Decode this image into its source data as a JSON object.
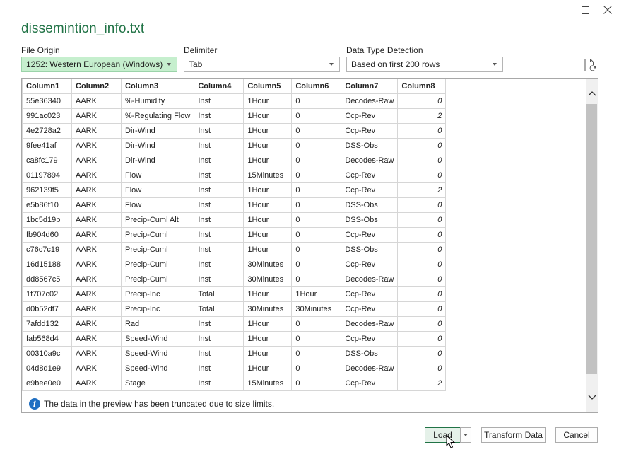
{
  "window": {
    "title": "dissemintion_info.txt"
  },
  "fields": {
    "file_origin": {
      "label": "File Origin",
      "value": "1252: Western European (Windows)"
    },
    "delimiter": {
      "label": "Delimiter",
      "value": "Tab"
    },
    "data_type_detection": {
      "label": "Data Type Detection",
      "value": "Based on first 200 rows"
    }
  },
  "table": {
    "columns": [
      "Column1",
      "Column2",
      "Column3",
      "Column4",
      "Column5",
      "Column6",
      "Column7",
      "Column8"
    ],
    "rows": [
      [
        "55e36340",
        "AARK",
        "%-Humidity",
        "Inst",
        "1Hour",
        "0",
        "Decodes-Raw",
        "0"
      ],
      [
        "991ac023",
        "AARK",
        "%-Regulating Flow",
        "Inst",
        "1Hour",
        "0",
        "Ccp-Rev",
        "2"
      ],
      [
        "4e2728a2",
        "AARK",
        "Dir-Wind",
        "Inst",
        "1Hour",
        "0",
        "Ccp-Rev",
        "0"
      ],
      [
        "9fee41af",
        "AARK",
        "Dir-Wind",
        "Inst",
        "1Hour",
        "0",
        "DSS-Obs",
        "0"
      ],
      [
        "ca8fc179",
        "AARK",
        "Dir-Wind",
        "Inst",
        "1Hour",
        "0",
        "Decodes-Raw",
        "0"
      ],
      [
        "01197894",
        "AARK",
        "Flow",
        "Inst",
        "15Minutes",
        "0",
        "Ccp-Rev",
        "0"
      ],
      [
        "962139f5",
        "AARK",
        "Flow",
        "Inst",
        "1Hour",
        "0",
        "Ccp-Rev",
        "2"
      ],
      [
        "e5b86f10",
        "AARK",
        "Flow",
        "Inst",
        "1Hour",
        "0",
        "DSS-Obs",
        "0"
      ],
      [
        "1bc5d19b",
        "AARK",
        "Precip-Cuml Alt",
        "Inst",
        "1Hour",
        "0",
        "DSS-Obs",
        "0"
      ],
      [
        "fb904d60",
        "AARK",
        "Precip-Cuml",
        "Inst",
        "1Hour",
        "0",
        "Ccp-Rev",
        "0"
      ],
      [
        "c76c7c19",
        "AARK",
        "Precip-Cuml",
        "Inst",
        "1Hour",
        "0",
        "DSS-Obs",
        "0"
      ],
      [
        "16d15188",
        "AARK",
        "Precip-Cuml",
        "Inst",
        "30Minutes",
        "0",
        "Ccp-Rev",
        "0"
      ],
      [
        "dd8567c5",
        "AARK",
        "Precip-Cuml",
        "Inst",
        "30Minutes",
        "0",
        "Decodes-Raw",
        "0"
      ],
      [
        "1f707c02",
        "AARK",
        "Precip-Inc",
        "Total",
        "1Hour",
        "1Hour",
        "Ccp-Rev",
        "0"
      ],
      [
        "d0b52df7",
        "AARK",
        "Precip-Inc",
        "Total",
        "30Minutes",
        "30Minutes",
        "Ccp-Rev",
        "0"
      ],
      [
        "7afdd132",
        "AARK",
        "Rad",
        "Inst",
        "1Hour",
        "0",
        "Decodes-Raw",
        "0"
      ],
      [
        "fab568d4",
        "AARK",
        "Speed-Wind",
        "Inst",
        "1Hour",
        "0",
        "Ccp-Rev",
        "0"
      ],
      [
        "00310a9c",
        "AARK",
        "Speed-Wind",
        "Inst",
        "1Hour",
        "0",
        "DSS-Obs",
        "0"
      ],
      [
        "04d8d1e9",
        "AARK",
        "Speed-Wind",
        "Inst",
        "1Hour",
        "0",
        "Decodes-Raw",
        "0"
      ],
      [
        "e9bee0e0",
        "AARK",
        "Stage",
        "Inst",
        "15Minutes",
        "0",
        "Ccp-Rev",
        "2"
      ]
    ]
  },
  "notice": {
    "text": "The data in the preview has been truncated due to size limits.",
    "icon": "info-icon"
  },
  "buttons": {
    "load": "Load",
    "transform": "Transform Data",
    "cancel": "Cancel"
  },
  "icons": {
    "maximize": "maximize-icon",
    "close": "close-icon",
    "refresh": "refresh-file-icon"
  },
  "colors": {
    "accent": "#217346",
    "selected_dropdown": "#c6efce"
  }
}
